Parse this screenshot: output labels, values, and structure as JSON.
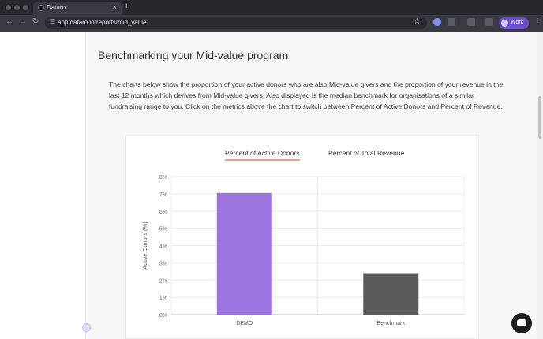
{
  "browser": {
    "tab_title": "Dataro",
    "url": "app.dataro.io/reports/mid_value",
    "profile_label": "Work"
  },
  "page": {
    "heading": "Benchmarking your Mid-value program",
    "description": "The charts below show the proportion of your active donors who are also Mid-value givers and the proportion of your revenue in the last 12 months which derives from Mid-value givers. Also displayed is the median benchmark for organisations of a similar fundraising range to you. Click on the metrics above the chart to switch between Percent of Active Donors and Percent of Revenue.",
    "chart_tabs": [
      "Percent of Active Donors",
      "Percent of Total Revenue"
    ],
    "active_tab": "Percent of Active Donors"
  },
  "chart_data": {
    "type": "bar",
    "categories": [
      "DEMO",
      "Benchmark"
    ],
    "values": [
      7.05,
      2.4
    ],
    "colors": [
      "#9b74e0",
      "#5a5a5a"
    ],
    "ylabel": "Active Donors (%)",
    "ylim": [
      0,
      8
    ],
    "yticks": [
      "0%",
      "1%",
      "2%",
      "3%",
      "4%",
      "5%",
      "6%",
      "7%",
      "8%"
    ],
    "grid": true
  }
}
